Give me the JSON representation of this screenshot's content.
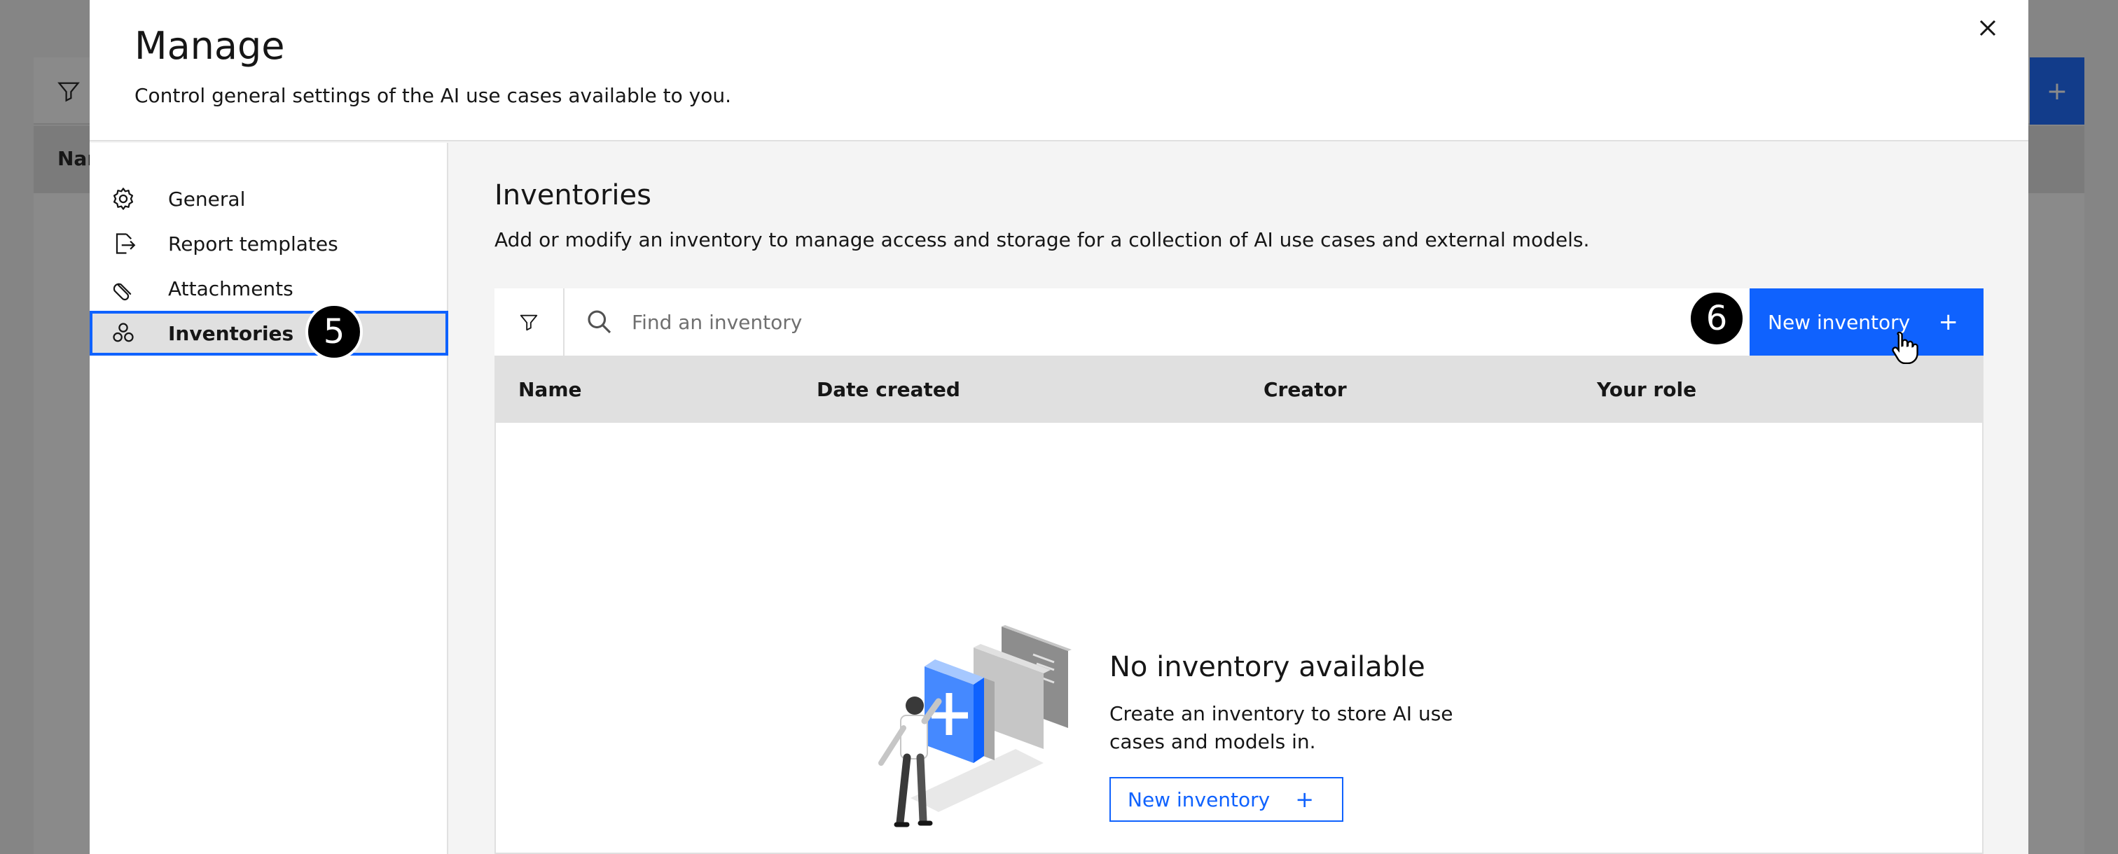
{
  "modal": {
    "title": "Manage",
    "subtitle": "Control general settings of the AI use cases available to you.",
    "close_icon": "close-icon"
  },
  "sidenav": {
    "items": [
      {
        "label": "General",
        "icon": "gear-icon"
      },
      {
        "label": "Report templates",
        "icon": "document-export-icon"
      },
      {
        "label": "Attachments",
        "icon": "attachment-icon"
      },
      {
        "label": "Inventories",
        "icon": "inventory-icon",
        "active": true
      }
    ]
  },
  "content": {
    "title": "Inventories",
    "description": "Add or modify an inventory to manage access and storage for a collection of AI use cases and external models.",
    "search_placeholder": "Find an inventory",
    "new_button_label": "New inventory",
    "new_button_icon": "+",
    "table": {
      "columns": [
        "Name",
        "Date created",
        "Creator",
        "Your role"
      ]
    },
    "empty_state": {
      "title": "No inventory available",
      "description": "Create an inventory to store AI use cases and models in.",
      "button_label": "New inventory",
      "button_icon": "+"
    }
  },
  "annotations": {
    "step5": "5",
    "step6": "6"
  },
  "background": {
    "header_fragment": "Nar",
    "add_icon": "+"
  },
  "colors": {
    "primary": "#0f62fe",
    "overlay": "rgba(22,22,22,0.5)"
  }
}
